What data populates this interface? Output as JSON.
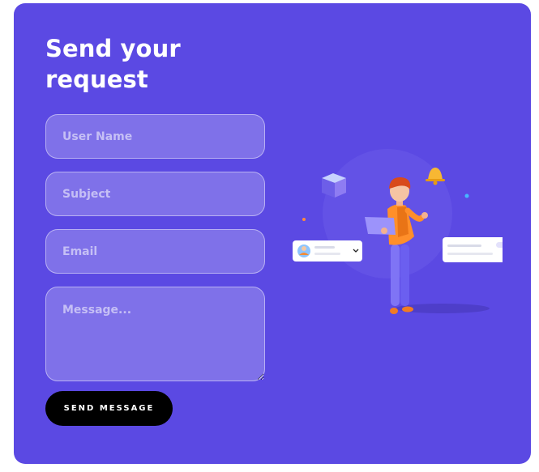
{
  "form": {
    "title": "Send your request",
    "username_placeholder": "User Name",
    "subject_placeholder": "Subject",
    "email_placeholder": "Email",
    "message_placeholder": "Message...",
    "send_label": "SEND MESSAGE"
  },
  "colors": {
    "card_background": "#5b49e3",
    "button_background": "#000000",
    "text": "#ffffff"
  },
  "icons": {
    "illustration": "person-with-laptop-illustration",
    "bell": "bell-icon",
    "cube": "cube-icon",
    "avatar": "avatar-icon",
    "chevron": "chevron-down-icon",
    "toggle": "toggle-icon"
  }
}
